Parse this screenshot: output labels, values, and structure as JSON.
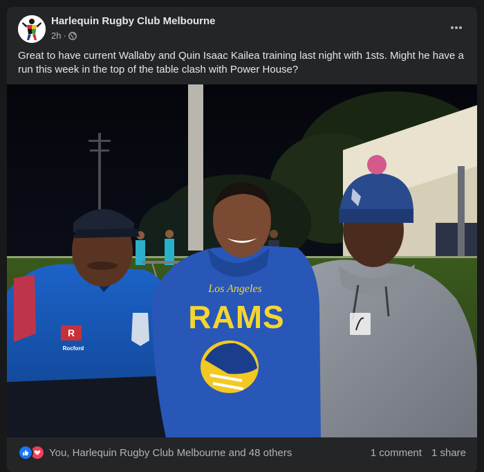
{
  "post": {
    "page_name": "Harlequin Rugby Club Melbourne",
    "time": "2h",
    "separator": "·",
    "audience_icon": "globe-icon",
    "more_icon": "more-options-icon",
    "more_label": "•••",
    "caption": "Great to have current Wallaby and Quin Isaac Kailea training last night with 1sts.  Might he have a run this week in the top of the table clash with Power House?"
  },
  "photo": {
    "hoodie_text_top": "Los Angeles",
    "hoodie_text_main": "RAMS",
    "jacket_badge": "Rocford"
  },
  "footer": {
    "reaction_icons": [
      "like-icon",
      "love-icon"
    ],
    "reactions_text": "You, Harlequin Rugby Club Melbourne and 48 others",
    "comments_text": "1 comment",
    "shares_text": "1 share"
  },
  "colors": {
    "background": "#18191a",
    "card": "#242526",
    "text_primary": "#e4e6eb",
    "text_secondary": "#b0b3b8",
    "like": "#1877f2",
    "love": "#f33e58"
  }
}
